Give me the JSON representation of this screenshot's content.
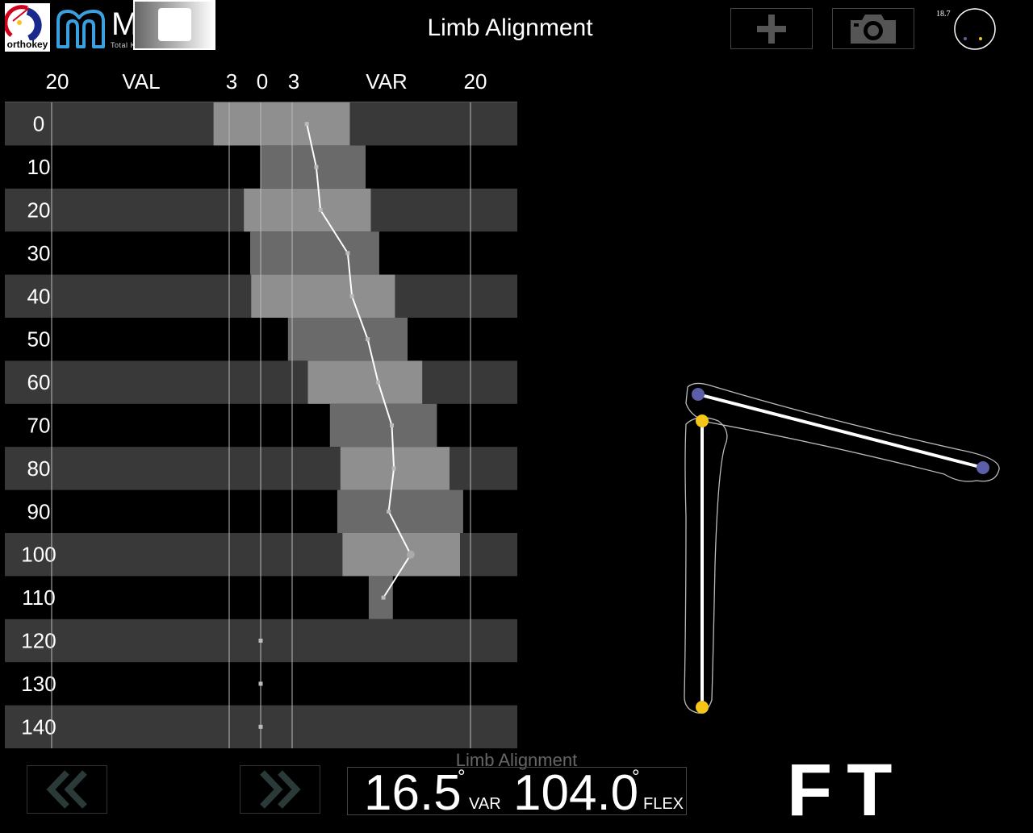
{
  "header": {
    "brand_name": "orthokey",
    "product_name": "Mirò",
    "product_subtitle": "Total Knee Arthroplasty",
    "title": "Limb Alignment",
    "add_icon": "plus-icon",
    "camera_icon": "camera-icon",
    "compass_value": "18.7"
  },
  "colors": {
    "femur_marker": "#5c5fa8",
    "tibia_marker": "#f5c518",
    "track": "#ffffff",
    "band_dark": "#393939",
    "range_light": "#8f8f8f",
    "range_mid": "#6a6a6a"
  },
  "chart_data": {
    "type": "bar",
    "x_ticks": [
      "20",
      "VAL",
      "3",
      "0",
      "3",
      "VAR",
      "20"
    ],
    "rows": [
      "0",
      "10",
      "20",
      "30",
      "40",
      "50",
      "60",
      "70",
      "80",
      "90",
      "100",
      "110",
      "120",
      "130",
      "140"
    ],
    "ranges": [
      [
        -4.5,
        8.5
      ],
      [
        0,
        10
      ],
      [
        -1.6,
        10.5
      ],
      [
        -1.0,
        11.3
      ],
      [
        -0.9,
        12.8
      ],
      [
        2.6,
        14.0
      ],
      [
        4.5,
        15.4
      ],
      [
        6.6,
        16.8
      ],
      [
        7.6,
        18.0
      ],
      [
        7.3,
        19.3
      ],
      [
        7.8,
        19.0
      ],
      [
        10.3,
        12.6
      ],
      null,
      null,
      null
    ],
    "track": [
      4.4,
      5.3,
      5.7,
      8.3,
      8.7,
      10.2,
      11.2,
      12.5,
      12.7,
      12.2,
      14.3,
      11.7,
      0,
      0,
      0
    ],
    "xlim": [
      -23,
      28
    ],
    "grid": true
  },
  "readout": {
    "caption": "Limb Alignment",
    "angle_value": "16.5",
    "angle_unit": "VAR",
    "flex_value": "104.0",
    "flex_unit": "FLEX",
    "degree_symbol": "°"
  },
  "controls": {
    "back_icon": "double-chevron-left-icon",
    "stop_icon": "stop-icon",
    "forward_icon": "double-chevron-right-icon"
  },
  "mode": "FT"
}
